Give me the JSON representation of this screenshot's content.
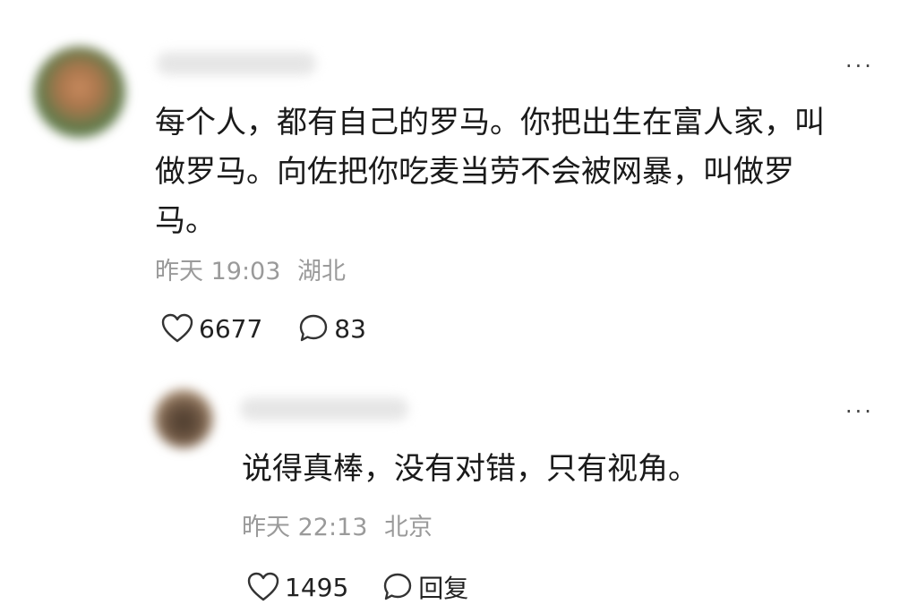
{
  "comments": [
    {
      "text": "每个人，都有自己的罗马。你把出生在富人家，叫做罗马。向佐把你吃麦当劳不会被网暴，叫做罗马。",
      "lines": [
        "每个人，都有自己的罗马。你把出生在富人家，叫",
        "做罗马。向佐把你吃麦当劳不会被网暴，叫做罗",
        "马。"
      ],
      "time": "昨天 19:03",
      "location": "湖北",
      "likes": "6677",
      "replies": "83",
      "more_icon": "ellipsis-icon"
    },
    {
      "text": "说得真棒，没有对错，只有视角。",
      "time": "昨天 22:13",
      "location": "北京",
      "likes": "1495",
      "reply_label": "回复",
      "more_icon": "ellipsis-icon"
    }
  ],
  "more_glyph": "···"
}
